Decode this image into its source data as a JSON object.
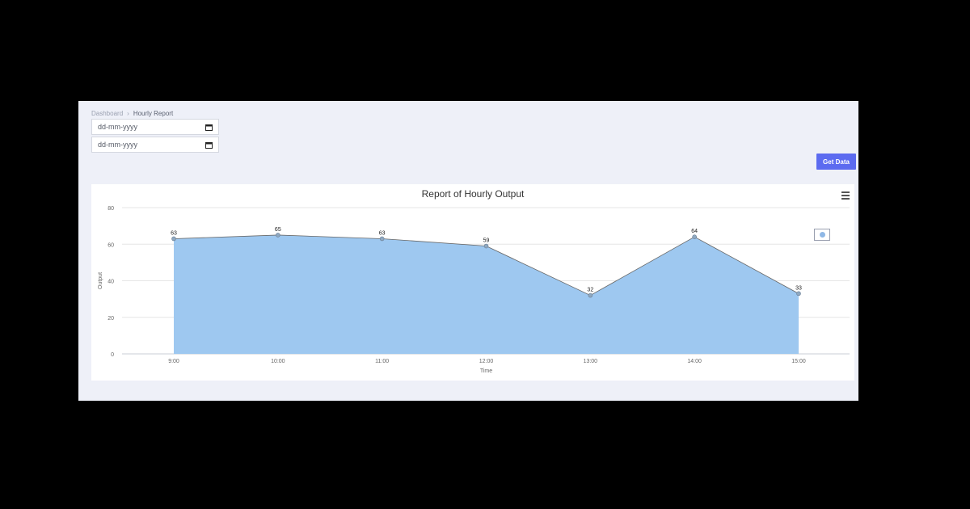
{
  "breadcrumb": {
    "root": "Dashboard",
    "separator": "›",
    "current": "Hourly Report"
  },
  "filters": {
    "start_date_placeholder": "dd-mm-yyyy",
    "end_date_placeholder": "dd-mm-yyyy"
  },
  "actions": {
    "get_data_label": "Get Data"
  },
  "colors": {
    "accent": "#5c6bf0",
    "area_fill": "#9ec8f0",
    "line": "#666666"
  },
  "chart_data": {
    "type": "area",
    "title": "Report of Hourly Output",
    "xlabel": "Time",
    "ylabel": "Output",
    "categories": [
      "9:00",
      "10:00",
      "11:00",
      "12:00",
      "13:00",
      "14:00",
      "15:00"
    ],
    "values": [
      63,
      65,
      63,
      59,
      32,
      64,
      33
    ],
    "ylim": [
      0,
      80
    ],
    "yticks": [
      0,
      20,
      40,
      60,
      80
    ],
    "grid": true,
    "legend": "top-right"
  }
}
